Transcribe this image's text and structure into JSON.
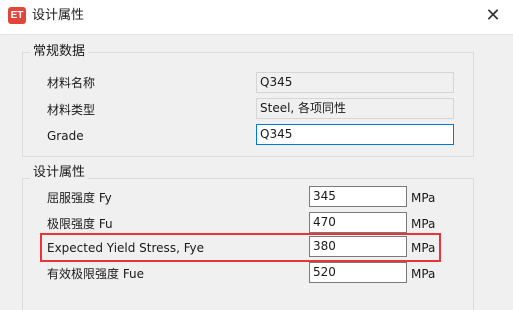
{
  "window": {
    "app_icon_text": "ET",
    "title": "设计属性",
    "close_glyph": "✕"
  },
  "general": {
    "title": "常规数据",
    "rows": [
      {
        "label": "材料名称",
        "value": "Q345"
      },
      {
        "label": "材料类型",
        "value": "Steel, 各项同性"
      },
      {
        "label": "Grade",
        "value": "Q345"
      }
    ]
  },
  "design": {
    "title": "设计属性",
    "rows": [
      {
        "label": "屈服强度 Fy",
        "value": "345",
        "unit": "MPa"
      },
      {
        "label": "极限强度 Fu",
        "value": "470",
        "unit": "MPa"
      },
      {
        "label": "Expected Yield Stress, Fye",
        "value": "380",
        "unit": "MPa"
      },
      {
        "label": "有效极限强度 Fue",
        "value": "520",
        "unit": "MPa"
      }
    ]
  },
  "colors": {
    "highlight_border": "#e8353a",
    "focus_border": "#0078d7",
    "app_icon_bg": "#e2453a"
  }
}
